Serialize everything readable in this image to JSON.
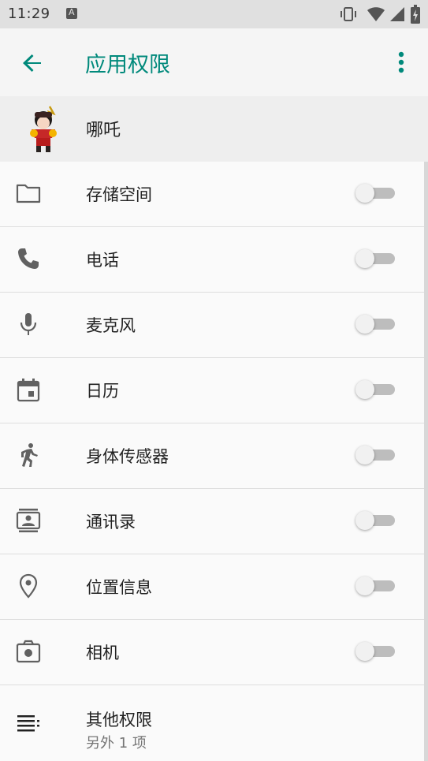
{
  "status_bar": {
    "time": "11:29",
    "icons": [
      "keyboard-a-icon",
      "vibrate-icon",
      "wifi-icon",
      "signal-icon",
      "battery-icon"
    ]
  },
  "app_bar": {
    "back_icon": "arrow-back-icon",
    "title": "应用权限",
    "menu_icon": "more-vert-icon",
    "accent_color": "#00897b"
  },
  "app_header": {
    "name": "哪吒",
    "avatar_icon": "app-avatar-icon"
  },
  "permissions": [
    {
      "label": "存储空间",
      "icon": "folder-icon",
      "enabled": false
    },
    {
      "label": "电话",
      "icon": "phone-icon",
      "enabled": false
    },
    {
      "label": "麦克风",
      "icon": "microphone-icon",
      "enabled": false
    },
    {
      "label": "日历",
      "icon": "calendar-icon",
      "enabled": false
    },
    {
      "label": "身体传感器",
      "icon": "walking-person-icon",
      "enabled": false
    },
    {
      "label": "通讯录",
      "icon": "contacts-icon",
      "enabled": false
    },
    {
      "label": "位置信息",
      "icon": "location-pin-icon",
      "enabled": false
    },
    {
      "label": "相机",
      "icon": "camera-icon",
      "enabled": false
    }
  ],
  "other_permissions": {
    "title": "其他权限",
    "subtitle": "另外 1 项",
    "icon": "list-icon"
  }
}
